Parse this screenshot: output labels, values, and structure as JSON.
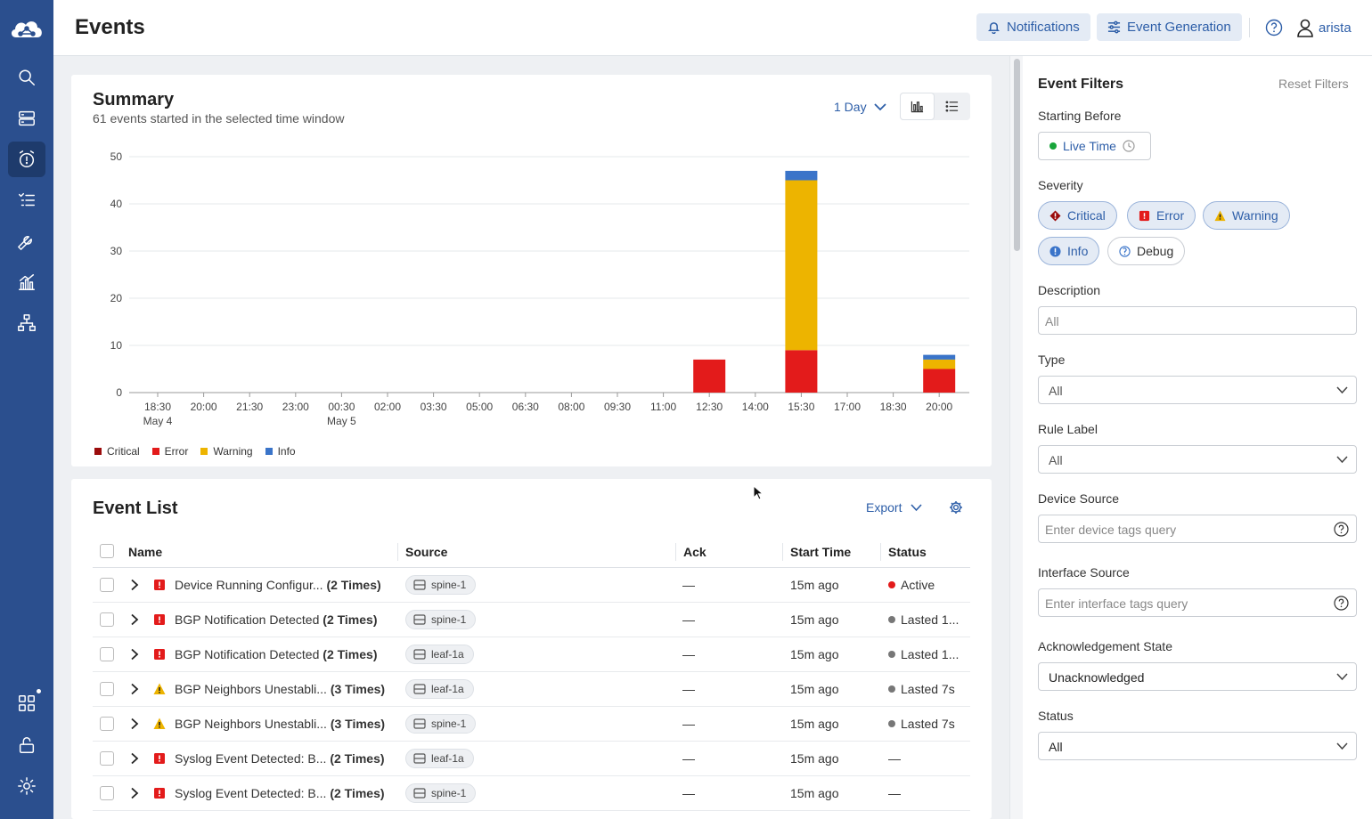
{
  "app": {
    "page_title": "Events",
    "user": "arista"
  },
  "header": {
    "notifications_label": "Notifications",
    "event_generation_label": "Event Generation"
  },
  "sidebar": {
    "items": [
      "search-icon",
      "devices-icon",
      "events-icon",
      "tasks-icon",
      "provisioning-icon",
      "dashboards-icon",
      "topology-icon",
      "apps-icon",
      "access-icon",
      "settings-icon"
    ],
    "active": "events-icon"
  },
  "summary": {
    "title": "Summary",
    "subtitle": "61 events started in the selected time window",
    "range": "1 Day"
  },
  "chart_data": {
    "type": "bar",
    "stacked": true,
    "categories": [
      "18:30",
      "20:00",
      "21:30",
      "23:00",
      "00:30",
      "02:00",
      "03:30",
      "05:00",
      "06:30",
      "08:00",
      "09:30",
      "11:00",
      "12:30",
      "14:00",
      "15:30",
      "17:00",
      "18:30",
      "20:00"
    ],
    "category_sublabels": {
      "0": "May 4",
      "4": "May 5"
    },
    "series": [
      {
        "name": "Critical",
        "color": "#9b0c0c",
        "values": [
          0,
          0,
          0,
          0,
          0,
          0,
          0,
          0,
          0,
          0,
          0,
          0,
          0,
          0,
          0,
          0,
          0,
          0
        ]
      },
      {
        "name": "Error",
        "color": "#e31b1b",
        "values": [
          0,
          0,
          0,
          0,
          0,
          0,
          0,
          0,
          0,
          0,
          0,
          0,
          7,
          0,
          9,
          0,
          0,
          5
        ]
      },
      {
        "name": "Warning",
        "color": "#edb400",
        "values": [
          0,
          0,
          0,
          0,
          0,
          0,
          0,
          0,
          0,
          0,
          0,
          0,
          0,
          0,
          36,
          0,
          0,
          2
        ]
      },
      {
        "name": "Info",
        "color": "#3a74c9",
        "values": [
          0,
          0,
          0,
          0,
          0,
          0,
          0,
          0,
          0,
          0,
          0,
          0,
          0,
          0,
          2,
          0,
          0,
          1
        ]
      }
    ],
    "yticks": [
      0,
      10,
      20,
      30,
      40,
      50
    ],
    "ylim": [
      0,
      50
    ],
    "grid": true,
    "legend": "bottom-left",
    "xlabel": "",
    "ylabel": ""
  },
  "event_list": {
    "title": "Event List",
    "export_label": "Export",
    "columns": [
      "Name",
      "Source",
      "Ack",
      "Start Time",
      "Status"
    ],
    "rows": [
      {
        "severity": "error",
        "name": "Device Running Configur...",
        "count": "(2 Times)",
        "source": "spine-1",
        "ack": "—",
        "start": "15m ago",
        "status": "Active",
        "status_color": "#e31b1b"
      },
      {
        "severity": "error",
        "name": "BGP Notification Detected",
        "count": "(2 Times)",
        "source": "spine-1",
        "ack": "—",
        "start": "15m ago",
        "status": "Lasted 1...",
        "status_color": "#777777"
      },
      {
        "severity": "error",
        "name": "BGP Notification Detected",
        "count": "(2 Times)",
        "source": "leaf-1a",
        "ack": "—",
        "start": "15m ago",
        "status": "Lasted 1...",
        "status_color": "#777777"
      },
      {
        "severity": "warning",
        "name": "BGP Neighbors Unestabli...",
        "count": "(3 Times)",
        "source": "leaf-1a",
        "ack": "—",
        "start": "15m ago",
        "status": "Lasted 7s",
        "status_color": "#777777"
      },
      {
        "severity": "warning",
        "name": "BGP Neighbors Unestabli...",
        "count": "(3 Times)",
        "source": "spine-1",
        "ack": "—",
        "start": "15m ago",
        "status": "Lasted 7s",
        "status_color": "#777777"
      },
      {
        "severity": "error",
        "name": "Syslog Event Detected: B...",
        "count": "(2 Times)",
        "source": "leaf-1a",
        "ack": "—",
        "start": "15m ago",
        "status": "—",
        "status_color": ""
      },
      {
        "severity": "error",
        "name": "Syslog Event Detected: B...",
        "count": "(2 Times)",
        "source": "spine-1",
        "ack": "—",
        "start": "15m ago",
        "status": "—",
        "status_color": ""
      }
    ]
  },
  "filters": {
    "title": "Event Filters",
    "reset_label": "Reset Filters",
    "starting_before_label": "Starting Before",
    "live_time_label": "Live Time",
    "severity_label": "Severity",
    "severities": [
      {
        "label": "Critical",
        "selected": true
      },
      {
        "label": "Error",
        "selected": true
      },
      {
        "label": "Warning",
        "selected": true
      },
      {
        "label": "Info",
        "selected": true
      },
      {
        "label": "Debug",
        "selected": false
      }
    ],
    "description_label": "Description",
    "description_value": "All",
    "type_label": "Type",
    "type_value": "All",
    "rule_label_label": "Rule Label",
    "rule_label_value": "All",
    "device_source_label": "Device Source",
    "device_source_placeholder": "Enter device tags query",
    "interface_source_label": "Interface Source",
    "interface_source_placeholder": "Enter interface tags query",
    "ack_state_label": "Acknowledgement State",
    "ack_state_value": "Unacknowledged",
    "status_label": "Status",
    "status_value": "All"
  }
}
